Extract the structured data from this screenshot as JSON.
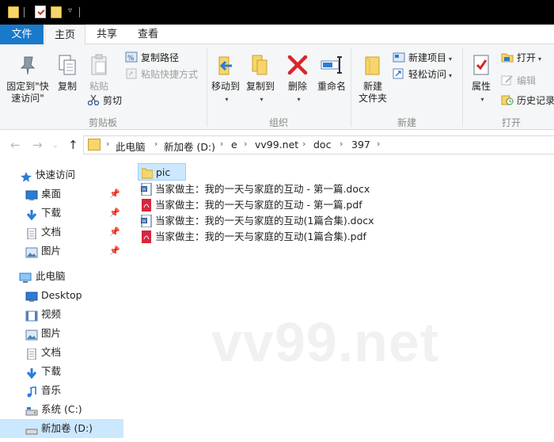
{
  "window": {
    "quick_access_chevron": "▿"
  },
  "tabs": {
    "file": "文件",
    "home": "主页",
    "share": "共享",
    "view": "查看"
  },
  "ribbon": {
    "clipboard": {
      "label": "剪贴板",
      "pin_label": "固定到\"快\n速访问\"",
      "copy": "复制",
      "paste": "粘贴",
      "copy_path": "复制路径",
      "paste_shortcut": "粘贴快捷方式",
      "cut": "剪切"
    },
    "organize": {
      "label": "组织",
      "move_to": "移动到",
      "copy_to": "复制到",
      "delete": "删除",
      "rename": "重命名"
    },
    "new": {
      "label": "新建",
      "new_folder": "新建\n文件夹",
      "new_item": "新建项目",
      "easy_access": "轻松访问"
    },
    "open": {
      "label": "打开",
      "properties": "属性",
      "open": "打开",
      "edit": "编辑",
      "history": "历史记录"
    }
  },
  "address": {
    "crumbs": [
      "此电脑",
      "新加卷 (D:)",
      "e",
      "vv99.net",
      "doc",
      "397"
    ]
  },
  "nav": {
    "quick_access": "快速访问",
    "desktop": "桌面",
    "downloads": "下载",
    "documents": "文档",
    "pictures": "图片",
    "this_pc": "此电脑",
    "pc_desktop": "Desktop",
    "videos": "视频",
    "pc_pictures": "图片",
    "pc_documents": "文档",
    "pc_downloads": "下载",
    "music": "音乐",
    "system_c": "系统 (C:)",
    "new_volume_d": "新加卷 (D:)"
  },
  "files": [
    {
      "name": "pic",
      "type": "folder"
    },
    {
      "name": "当家做主：我的一天与家庭的互动 - 第一篇.docx",
      "type": "docx"
    },
    {
      "name": "当家做主：我的一天与家庭的互动 - 第一篇.pdf",
      "type": "pdf"
    },
    {
      "name": "当家做主：我的一天与家庭的互动(1篇合集).docx",
      "type": "docx"
    },
    {
      "name": "当家做主：我的一天与家庭的互动(1篇合集).pdf",
      "type": "pdf"
    }
  ],
  "watermark": "vv99.net",
  "colors": {
    "accent": "#1979ca",
    "selection": "#cce8ff",
    "folder": "#f7d56a",
    "pdf": "#d9263c",
    "word": "#2b5797"
  }
}
